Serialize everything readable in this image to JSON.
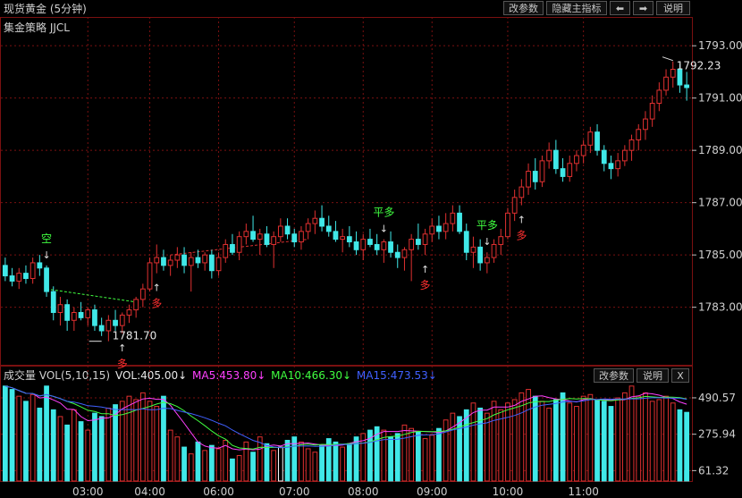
{
  "header": {
    "title": "现货黄金 (5分钟)",
    "buttons": [
      "改参数",
      "隐藏主指标",
      "⬅",
      "➡",
      "说明"
    ]
  },
  "strategy_label": "集金策略 JJCL",
  "volume_header": {
    "label": "成交量 VOL(5,10,15)",
    "vol": "VOL:405.00↓",
    "ma5": "MA5:453.80↓",
    "ma10": "MA10:466.30↓",
    "ma15": "MA15:473.53↓",
    "buttons": [
      "改参数",
      "说明",
      "X"
    ]
  },
  "colors": {
    "up": "#e03030",
    "down": "#40e8e8",
    "ma5": "#ff40ff",
    "ma10": "#40ff40",
    "ma15": "#4060ff",
    "grid": "#7a1010",
    "signal_short": "#40ff40",
    "signal_long": "#ff3030",
    "signal_close": "#40ff40"
  },
  "chart_data": [
    {
      "type": "candlestick",
      "title": "现货黄金 (5分钟)",
      "y_ticks": [
        "1793.00",
        "1791.00",
        "1789.00",
        "1787.00",
        "1785.00",
        "1783.00"
      ],
      "ylim": [
        1780.8,
        1794.1
      ],
      "x_ticks": [
        "03:00",
        "04:00",
        "06:00",
        "07:00",
        "08:00",
        "09:00",
        "10:00",
        "11:00"
      ],
      "annotations": [
        {
          "text": "空",
          "kind": "short",
          "bar": 6
        },
        {
          "text": "多",
          "kind": "long",
          "bar": 22
        },
        {
          "text": "平多",
          "kind": "close",
          "bar": 55
        },
        {
          "text": "多",
          "kind": "long",
          "bar": 61
        },
        {
          "text": "平多",
          "kind": "close",
          "bar": 70
        },
        {
          "text": "多",
          "kind": "long",
          "bar": 75
        },
        {
          "text": "多",
          "kind": "long",
          "bar": 17
        }
      ],
      "value_labels": [
        "1781.70",
        "1792.23"
      ],
      "ohlc": [
        [
          1784.6,
          1784.9,
          1784.0,
          1784.2
        ],
        [
          1784.2,
          1784.5,
          1783.8,
          1784.0
        ],
        [
          1784.0,
          1784.5,
          1783.7,
          1784.3
        ],
        [
          1784.3,
          1784.6,
          1783.9,
          1784.1
        ],
        [
          1784.1,
          1784.9,
          1783.9,
          1784.7
        ],
        [
          1784.7,
          1785.0,
          1784.2,
          1784.5
        ],
        [
          1784.5,
          1784.6,
          1783.4,
          1783.6
        ],
        [
          1783.6,
          1783.8,
          1782.5,
          1782.8
        ],
        [
          1782.8,
          1783.4,
          1782.3,
          1783.1
        ],
        [
          1783.1,
          1783.3,
          1782.1,
          1782.5
        ],
        [
          1782.5,
          1783.0,
          1782.1,
          1782.8
        ],
        [
          1782.8,
          1783.2,
          1782.5,
          1782.6
        ],
        [
          1782.6,
          1783.0,
          1782.3,
          1782.9
        ],
        [
          1782.9,
          1783.1,
          1782.1,
          1782.3
        ],
        [
          1782.3,
          1782.6,
          1781.9,
          1782.1
        ],
        [
          1782.1,
          1782.7,
          1781.7,
          1782.5
        ],
        [
          1782.5,
          1782.9,
          1782.1,
          1782.3
        ],
        [
          1782.3,
          1782.8,
          1782.0,
          1782.7
        ],
        [
          1782.7,
          1783.1,
          1782.4,
          1782.9
        ],
        [
          1782.9,
          1783.4,
          1782.6,
          1783.3
        ],
        [
          1783.3,
          1783.9,
          1783.0,
          1783.7
        ],
        [
          1783.7,
          1784.9,
          1783.6,
          1784.7
        ],
        [
          1784.7,
          1785.4,
          1784.3,
          1784.9
        ],
        [
          1784.9,
          1785.2,
          1784.4,
          1784.6
        ],
        [
          1784.6,
          1785.0,
          1784.2,
          1784.8
        ],
        [
          1784.8,
          1785.3,
          1784.5,
          1785.0
        ],
        [
          1785.0,
          1785.3,
          1784.3,
          1784.6
        ],
        [
          1784.6,
          1785.1,
          1783.6,
          1784.9
        ],
        [
          1784.9,
          1785.2,
          1784.5,
          1784.7
        ],
        [
          1784.7,
          1785.1,
          1784.4,
          1785.0
        ],
        [
          1785.0,
          1785.2,
          1784.1,
          1784.4
        ],
        [
          1784.4,
          1785.1,
          1784.2,
          1784.9
        ],
        [
          1784.9,
          1785.6,
          1784.7,
          1785.4
        ],
        [
          1785.4,
          1785.8,
          1785.0,
          1785.1
        ],
        [
          1785.1,
          1785.9,
          1784.8,
          1785.7
        ],
        [
          1785.7,
          1786.2,
          1785.4,
          1785.9
        ],
        [
          1785.9,
          1786.5,
          1785.5,
          1785.6
        ],
        [
          1785.6,
          1786.0,
          1785.0,
          1785.8
        ],
        [
          1785.8,
          1786.1,
          1785.3,
          1785.4
        ],
        [
          1785.4,
          1785.9,
          1784.5,
          1785.7
        ],
        [
          1785.7,
          1786.4,
          1785.5,
          1786.1
        ],
        [
          1786.1,
          1786.4,
          1785.6,
          1785.8
        ],
        [
          1785.8,
          1786.0,
          1785.3,
          1785.5
        ],
        [
          1785.5,
          1786.1,
          1785.2,
          1785.9
        ],
        [
          1785.9,
          1786.4,
          1785.6,
          1786.2
        ],
        [
          1786.2,
          1786.7,
          1785.8,
          1786.4
        ],
        [
          1786.4,
          1786.9,
          1785.9,
          1786.1
        ],
        [
          1786.1,
          1786.5,
          1785.7,
          1785.9
        ],
        [
          1785.9,
          1786.3,
          1785.5,
          1785.6
        ],
        [
          1785.6,
          1786.0,
          1785.1,
          1785.7
        ],
        [
          1785.7,
          1786.1,
          1785.3,
          1785.5
        ],
        [
          1785.5,
          1785.9,
          1785.0,
          1785.2
        ],
        [
          1785.2,
          1785.8,
          1784.8,
          1785.6
        ],
        [
          1785.6,
          1786.0,
          1785.3,
          1785.4
        ],
        [
          1785.4,
          1785.8,
          1785.0,
          1785.2
        ],
        [
          1785.2,
          1785.6,
          1784.7,
          1785.5
        ],
        [
          1785.5,
          1785.9,
          1784.9,
          1785.1
        ],
        [
          1785.1,
          1785.4,
          1784.5,
          1784.9
        ],
        [
          1784.9,
          1785.3,
          1784.4,
          1785.2
        ],
        [
          1785.2,
          1785.8,
          1784.0,
          1785.6
        ],
        [
          1785.6,
          1786.2,
          1785.2,
          1785.4
        ],
        [
          1785.4,
          1786.0,
          1785.0,
          1785.8
        ],
        [
          1785.8,
          1786.4,
          1785.5,
          1786.1
        ],
        [
          1786.1,
          1786.5,
          1785.6,
          1785.9
        ],
        [
          1785.9,
          1786.6,
          1785.6,
          1786.2
        ],
        [
          1786.2,
          1786.9,
          1785.9,
          1786.6
        ],
        [
          1786.6,
          1786.9,
          1785.8,
          1785.9
        ],
        [
          1785.9,
          1786.2,
          1784.8,
          1785.1
        ],
        [
          1785.1,
          1785.7,
          1784.5,
          1785.3
        ],
        [
          1785.3,
          1785.6,
          1784.4,
          1784.7
        ],
        [
          1784.7,
          1785.1,
          1784.3,
          1784.9
        ],
        [
          1784.9,
          1785.6,
          1784.7,
          1785.4
        ],
        [
          1785.4,
          1786.0,
          1785.0,
          1785.7
        ],
        [
          1785.7,
          1786.8,
          1785.6,
          1786.6
        ],
        [
          1786.6,
          1787.5,
          1786.3,
          1787.2
        ],
        [
          1787.2,
          1787.9,
          1786.9,
          1787.6
        ],
        [
          1787.6,
          1788.5,
          1787.3,
          1788.2
        ],
        [
          1788.2,
          1788.7,
          1787.5,
          1787.8
        ],
        [
          1787.8,
          1788.8,
          1787.6,
          1788.6
        ],
        [
          1788.6,
          1789.3,
          1788.3,
          1789.0
        ],
        [
          1789.0,
          1789.4,
          1788.1,
          1788.3
        ],
        [
          1788.3,
          1788.7,
          1787.8,
          1788.0
        ],
        [
          1788.0,
          1788.8,
          1787.8,
          1788.5
        ],
        [
          1788.5,
          1789.0,
          1788.2,
          1788.8
        ],
        [
          1788.8,
          1789.4,
          1788.5,
          1789.2
        ],
        [
          1789.2,
          1789.9,
          1788.9,
          1789.7
        ],
        [
          1789.7,
          1790.0,
          1788.8,
          1789.0
        ],
        [
          1789.0,
          1789.2,
          1788.2,
          1788.5
        ],
        [
          1788.5,
          1788.8,
          1787.9,
          1788.3
        ],
        [
          1788.3,
          1788.9,
          1788.0,
          1788.6
        ],
        [
          1788.6,
          1789.2,
          1788.4,
          1789.0
        ],
        [
          1789.0,
          1789.6,
          1788.6,
          1789.4
        ],
        [
          1789.4,
          1790.0,
          1789.0,
          1789.8
        ],
        [
          1789.8,
          1790.5,
          1789.4,
          1790.2
        ],
        [
          1790.2,
          1791.1,
          1789.9,
          1790.8
        ],
        [
          1790.8,
          1791.6,
          1790.5,
          1791.3
        ],
        [
          1791.3,
          1792.1,
          1791.1,
          1791.8
        ],
        [
          1791.8,
          1792.4,
          1791.4,
          1792.1
        ],
        [
          1792.1,
          1792.3,
          1791.2,
          1791.5
        ],
        [
          1791.5,
          1792.0,
          1790.9,
          1791.4
        ]
      ],
      "ma_line_segments": [
        [
          6,
          19,
          1783.7,
          1783.2
        ],
        [
          24,
          44,
          1785.0,
          1785.6
        ]
      ]
    },
    {
      "type": "bar",
      "title": "成交量 VOL(5,10,15)",
      "y_ticks": [
        "490.57",
        "275.94",
        "61.32"
      ],
      "ylim": [
        0,
        580
      ],
      "series": [
        {
          "name": "MA5",
          "values_from": "volume"
        },
        {
          "name": "MA10",
          "values_from": "volume"
        },
        {
          "name": "MA15",
          "values_from": "volume"
        }
      ],
      "volume": [
        560,
        540,
        500,
        470,
        510,
        430,
        560,
        420,
        380,
        330,
        420,
        350,
        300,
        400,
        380,
        430,
        450,
        470,
        500,
        480,
        520,
        470,
        440,
        500,
        300,
        260,
        200,
        160,
        230,
        180,
        210,
        190,
        240,
        130,
        150,
        230,
        170,
        260,
        220,
        180,
        200,
        240,
        260,
        230,
        190,
        170,
        210,
        250,
        230,
        200,
        220,
        260,
        280,
        300,
        320,
        300,
        260,
        280,
        330,
        310,
        290,
        250,
        270,
        310,
        360,
        400,
        380,
        420,
        460,
        430,
        400,
        470,
        420,
        460,
        480,
        520,
        540,
        500,
        470,
        430,
        480,
        520,
        460,
        440,
        500,
        510,
        480,
        470,
        440,
        490,
        520,
        560,
        500,
        520,
        470,
        480,
        500,
        460,
        420,
        405,
        60
      ]
    }
  ]
}
